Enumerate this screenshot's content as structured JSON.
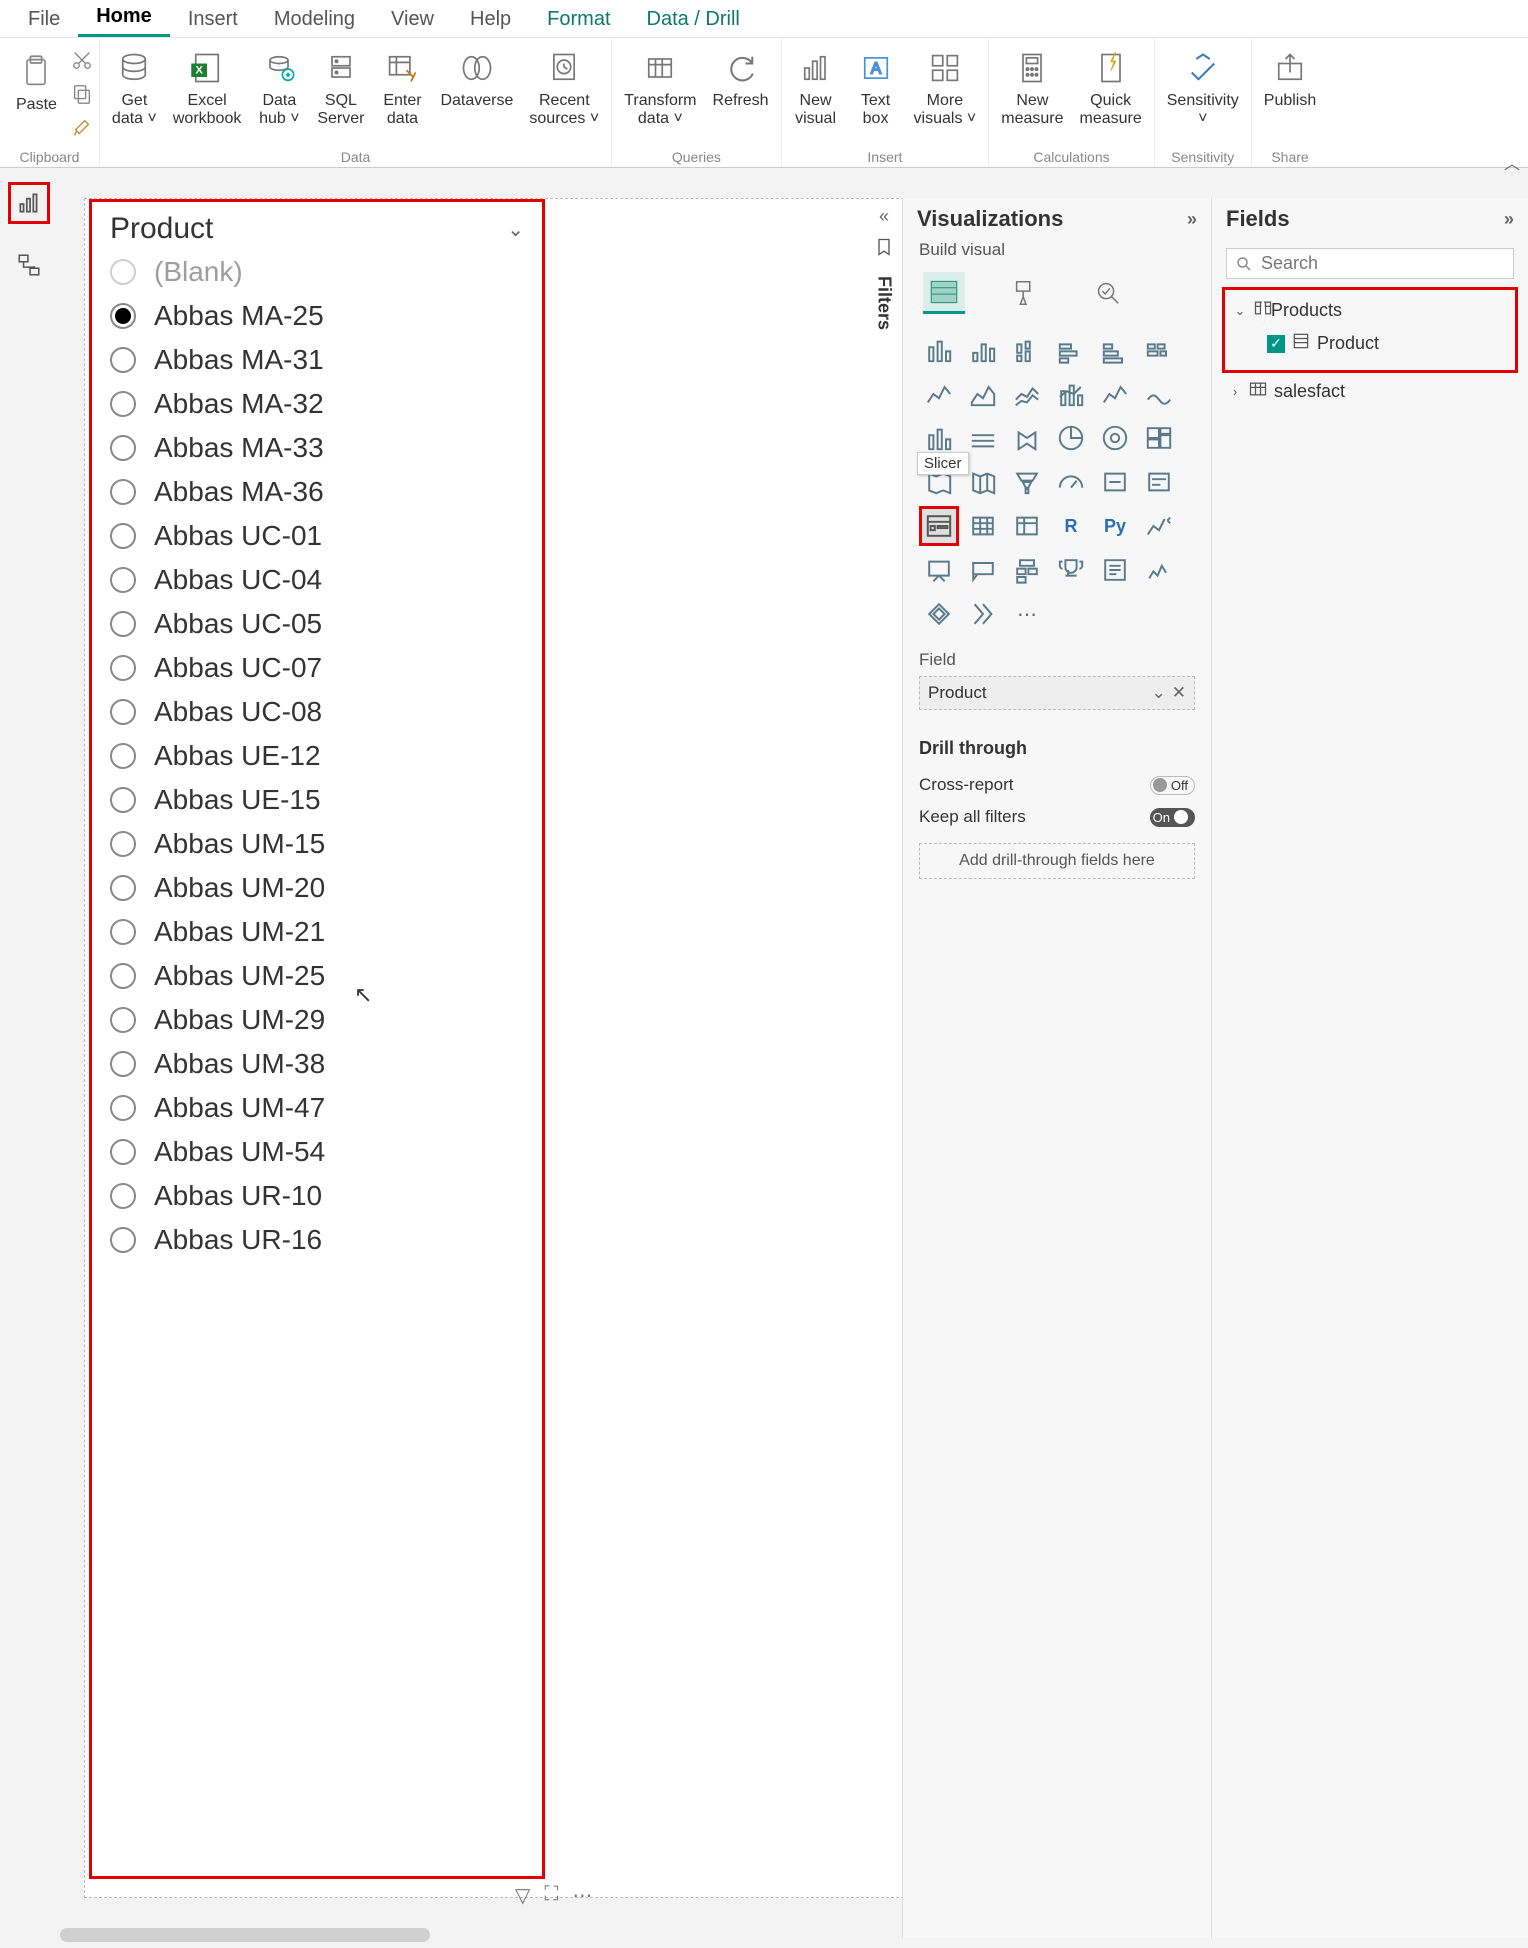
{
  "ribbon": {
    "tabs": [
      "File",
      "Home",
      "Insert",
      "Modeling",
      "View",
      "Help",
      "Format",
      "Data / Drill"
    ],
    "active_tab": "Home",
    "contextual_tabs": [
      "Format",
      "Data / Drill"
    ],
    "groups": {
      "clipboard": {
        "label": "Clipboard",
        "paste": "Paste"
      },
      "data": {
        "label": "Data",
        "get_data": "Get\ndata ˅",
        "excel": "Excel\nworkbook",
        "data_hub": "Data\nhub ˅",
        "sql": "SQL\nServer",
        "enter": "Enter\ndata",
        "dataverse": "Dataverse",
        "recent": "Recent\nsources ˅"
      },
      "queries": {
        "label": "Queries",
        "transform": "Transform\ndata ˅",
        "refresh": "Refresh"
      },
      "insert": {
        "label": "Insert",
        "new_visual": "New\nvisual",
        "text_box": "Text\nbox",
        "more": "More\nvisuals ˅"
      },
      "calc": {
        "label": "Calculations",
        "new_measure": "New\nmeasure",
        "quick": "Quick\nmeasure"
      },
      "sensitivity": {
        "label": "Sensitivity",
        "btn": "Sensitivity\n˅"
      },
      "share": {
        "label": "Share",
        "publish": "Publish"
      }
    }
  },
  "panes": {
    "filters_label": "Filters",
    "visualizations": {
      "title": "Visualizations",
      "subtitle": "Build visual",
      "slicer_tooltip": "Slicer",
      "field_label": "Field",
      "field_value": "Product",
      "drill_title": "Drill through",
      "cross_report": "Cross-report",
      "cross_report_state": "Off",
      "keep_filters": "Keep all filters",
      "keep_filters_state": "On",
      "drop_hint": "Add drill-through fields here"
    },
    "fields": {
      "title": "Fields",
      "search_placeholder": "Search",
      "tables": [
        {
          "name": "Products",
          "expanded": true,
          "checked": true,
          "columns": [
            {
              "name": "Product",
              "checked": true
            }
          ]
        },
        {
          "name": "salesfact",
          "expanded": false
        }
      ]
    }
  },
  "slicer": {
    "title": "Product",
    "selected": "Abbas MA-25",
    "items": [
      "(Blank)",
      "Abbas MA-25",
      "Abbas MA-31",
      "Abbas MA-32",
      "Abbas MA-33",
      "Abbas MA-36",
      "Abbas UC-01",
      "Abbas UC-04",
      "Abbas UC-05",
      "Abbas UC-07",
      "Abbas UC-08",
      "Abbas UE-12",
      "Abbas UE-15",
      "Abbas UM-15",
      "Abbas UM-20",
      "Abbas UM-21",
      "Abbas UM-25",
      "Abbas UM-29",
      "Abbas UM-38",
      "Abbas UM-47",
      "Abbas UM-54",
      "Abbas UR-10",
      "Abbas UR-16"
    ]
  }
}
